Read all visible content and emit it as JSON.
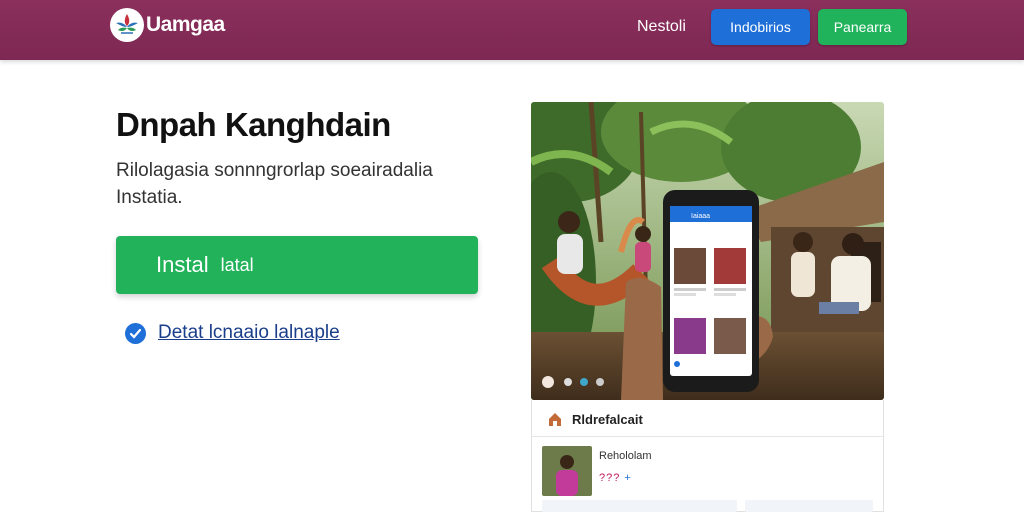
{
  "header": {
    "logo_text": "Uamgaa",
    "nav_link": "Nestoli",
    "btn_blue": "Indobirios",
    "btn_green": "Panearra"
  },
  "hero": {
    "title": "Dnpah Kanghdain",
    "subtitle": "Rilolagasia sonnngrorlap soeairadalia Instatia.",
    "install_main": "Instal",
    "install_sub": "latal",
    "check_link": "Detat lcnaaio lalnaple"
  },
  "phone": {
    "header_title": "Iaiaaa"
  },
  "card": {
    "title": "Rldrefalcait",
    "item_name": "Rehololam",
    "item_meta": "???",
    "item_meta_plus": "+"
  },
  "colors": {
    "header": "#7d2853",
    "accent_blue": "#1f6fd8",
    "accent_green": "#22b35a"
  }
}
